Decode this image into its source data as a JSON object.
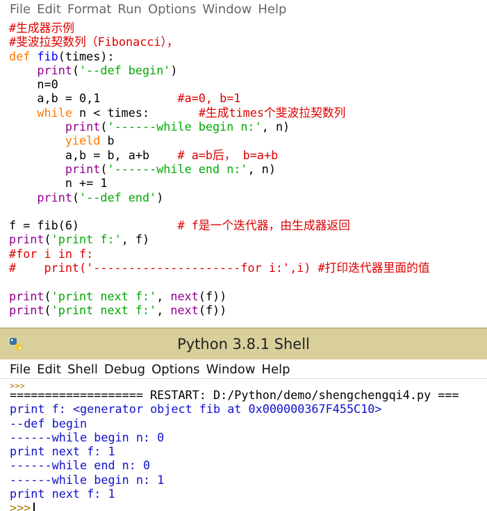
{
  "editor": {
    "menu": [
      "File",
      "Edit",
      "Format",
      "Run",
      "Options",
      "Window",
      "Help"
    ],
    "code": {
      "l1": "#生成器示例",
      "l2": "#斐波拉契数列（Fibonacci），",
      "l3_kw": "def",
      "l3_fn": "fib",
      "l3_rest": "(times):",
      "l4_indent": "    ",
      "l4_bi": "print",
      "l4_p1": "(",
      "l4_str": "'--def begin'",
      "l4_p2": ")",
      "l5": "    n=0",
      "l6_code": "    a,b = 0,1           ",
      "l6_cm": "#a=0, b=1",
      "l7_indent": "    ",
      "l7_kw": "while",
      "l7_code": " n < times:       ",
      "l7_cm": "#生成times个斐波拉契数列",
      "l8_indent": "        ",
      "l8_bi": "print",
      "l8_p1": "(",
      "l8_str": "'------while begin n:'",
      "l8_p2": ", n)",
      "l9_indent": "        ",
      "l9_kw": "yield",
      "l9_code": " b",
      "l10_code": "        a,b = b, a+b    ",
      "l10_cm": "# a=b后， b=a+b",
      "l11_indent": "        ",
      "l11_bi": "print",
      "l11_p1": "(",
      "l11_str": "'------while end n:'",
      "l11_p2": ", n)",
      "l12": "        n += 1",
      "l13_indent": "    ",
      "l13_bi": "print",
      "l13_p1": "(",
      "l13_str": "'--def end'",
      "l13_p2": ")",
      "l14": "",
      "l15_code": "f = fib(6)              ",
      "l15_cm": "# f是一个迭代器，由生成器返回",
      "l16_bi": "print",
      "l16_p1": "(",
      "l16_str": "'print f:'",
      "l16_p2": ", f)",
      "l17": "#for i in f:",
      "l18": "#    print('---------------------for i:',i) #打印迭代器里面的值",
      "l19": "",
      "l20_bi": "print",
      "l20_p1": "(",
      "l20_str": "'print next f:'",
      "l20_p2": ", ",
      "l20_bi2": "next",
      "l20_p3": "(f))",
      "l21_bi": "print",
      "l21_p1": "(",
      "l21_str": "'print next f:'",
      "l21_p2": ", ",
      "l21_bi2": "next",
      "l21_p3": "(f))"
    }
  },
  "shell": {
    "title": "Python 3.8.1 Shell",
    "menu": [
      "File",
      "Edit",
      "Shell",
      "Debug",
      "Options",
      "Window",
      "Help"
    ],
    "prev_prompt": ">>>",
    "lines": [
      "=================== RESTART: D:/Python/demo/shengchengqi4.py ===",
      "print f: <generator object fib at 0x000000367F455C10>",
      "--def begin",
      "------while begin n: 0",
      "print next f: 1",
      "------while end n: 0",
      "------while begin n: 1",
      "print next f: 1"
    ],
    "prompt": ">>>"
  },
  "colors": {
    "keyword": "#ff7700",
    "string": "#00aa00",
    "builtin": "#900090",
    "comment": "#dd0000",
    "output": "#1010cc",
    "titlebar": "#d9cf9b"
  }
}
